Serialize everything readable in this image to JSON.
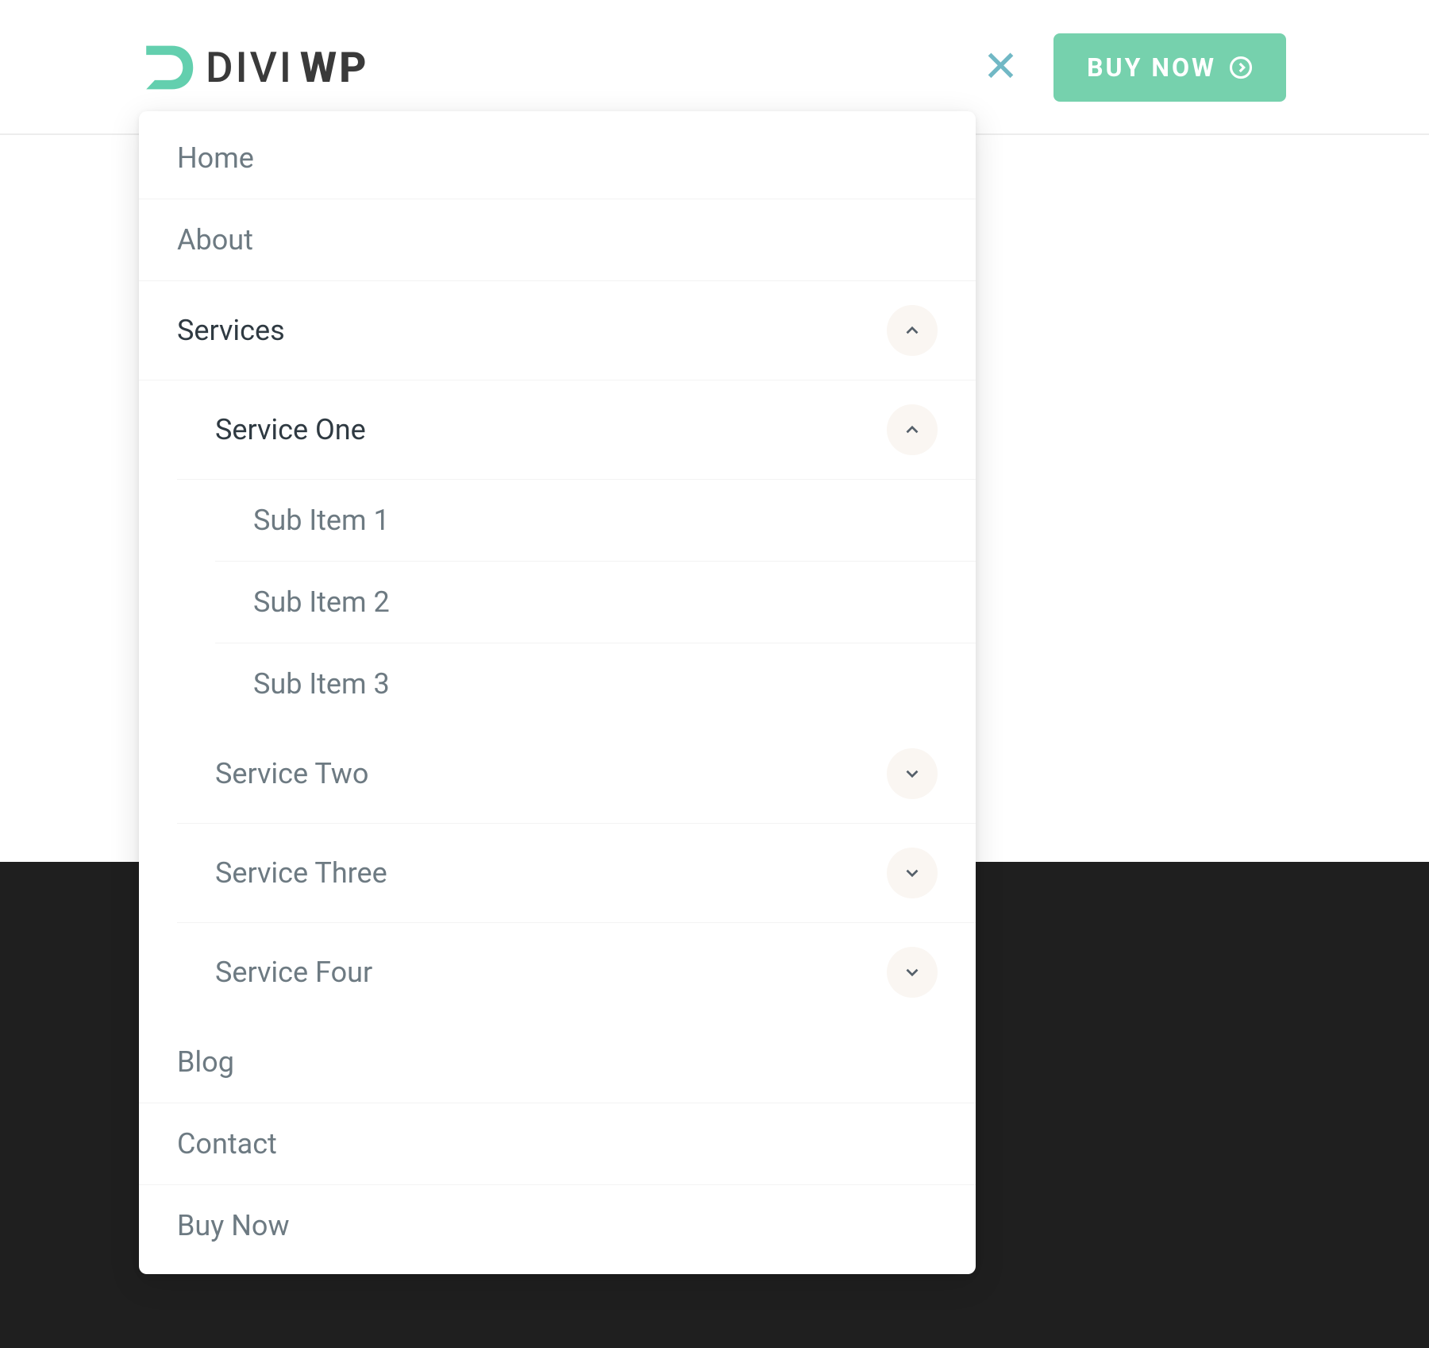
{
  "brand": {
    "divi": "DIVI",
    "wp": "WP"
  },
  "cta": {
    "label": "BUY NOW"
  },
  "menu": {
    "home": "Home",
    "about": "About",
    "services": "Services",
    "service_one": "Service One",
    "sub1": "Sub Item 1",
    "sub2": "Sub Item 2",
    "sub3": "Sub Item 3",
    "service_two": "Service Two",
    "service_three": "Service Three",
    "service_four": "Service Four",
    "blog": "Blog",
    "contact": "Contact",
    "buy_now": "Buy Now"
  }
}
